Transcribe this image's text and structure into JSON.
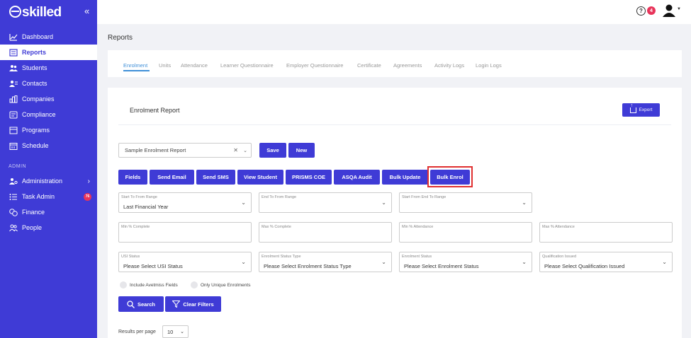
{
  "brand": {
    "logo_text": "skilled"
  },
  "sidebar": {
    "items": [
      {
        "label": "Dashboard",
        "icon": "dashboard-icon"
      },
      {
        "label": "Reports",
        "icon": "reports-icon"
      },
      {
        "label": "Students",
        "icon": "students-icon"
      },
      {
        "label": "Contacts",
        "icon": "contacts-icon"
      },
      {
        "label": "Companies",
        "icon": "companies-icon"
      },
      {
        "label": "Compliance",
        "icon": "compliance-icon"
      },
      {
        "label": "Programs",
        "icon": "programs-icon"
      },
      {
        "label": "Schedule",
        "icon": "schedule-icon"
      }
    ],
    "admin_label": "ADMIN",
    "admin_items": [
      {
        "label": "Administration",
        "icon": "administration-icon"
      },
      {
        "label": "Task Admin",
        "icon": "task-admin-icon",
        "badge": "76"
      },
      {
        "label": "Finance",
        "icon": "finance-icon"
      },
      {
        "label": "People",
        "icon": "people-icon"
      }
    ]
  },
  "topbar": {
    "help_icon": "?",
    "help_badge": "4"
  },
  "page": {
    "title": "Reports"
  },
  "tabs": [
    "Enrolment",
    "Units",
    "Attendance",
    "Learner Questionnaire",
    "Employer Questionnaire",
    "Certificate",
    "Agreements",
    "Activity Logs",
    "Login Logs"
  ],
  "card": {
    "title": "Enrolment Report",
    "export_label": "Export",
    "report_select": "Sample Enrolment Report",
    "save_label": "Save",
    "new_label": "New",
    "actions": [
      "Fields",
      "Send Email",
      "Send SMS",
      "View Student",
      "PRISMS COE",
      "ASQA Audit",
      "Bulk Update",
      "Bulk Enrol"
    ],
    "filters_row1": [
      {
        "label": "Start To From Range",
        "value": "Last Financial Year"
      },
      {
        "label": "End To From Range",
        "value": ""
      },
      {
        "label": "Start From End To Range",
        "value": ""
      }
    ],
    "filters_row2": [
      {
        "label": "Min % Complete",
        "value": ""
      },
      {
        "label": "Max % Complete",
        "value": ""
      },
      {
        "label": "Min % Attendance",
        "value": ""
      },
      {
        "label": "Max % Attendance",
        "value": ""
      }
    ],
    "filters_row3": [
      {
        "label": "USI Status",
        "value": "Please Select USI Status"
      },
      {
        "label": "Enrolment Status Type",
        "value": "Please Select Enrolment Status Type"
      },
      {
        "label": "Enrolment Status",
        "value": "Please Select Enrolment Status"
      },
      {
        "label": "Qualification Issued",
        "value": "Please Select Qualification Issued"
      }
    ],
    "checkbox_avetmiss": "Include Avetmiss Fields",
    "checkbox_unique": "Only Unique Enrolments",
    "search_label": "Search",
    "clear_label": "Clear Filters",
    "rpp_label": "Results per page",
    "rpp_value": "10"
  },
  "colors": {
    "brand": "#3f3bd6",
    "badge": "#e8345a",
    "active_tab": "#3f8fd8",
    "highlight": "#e03030"
  }
}
